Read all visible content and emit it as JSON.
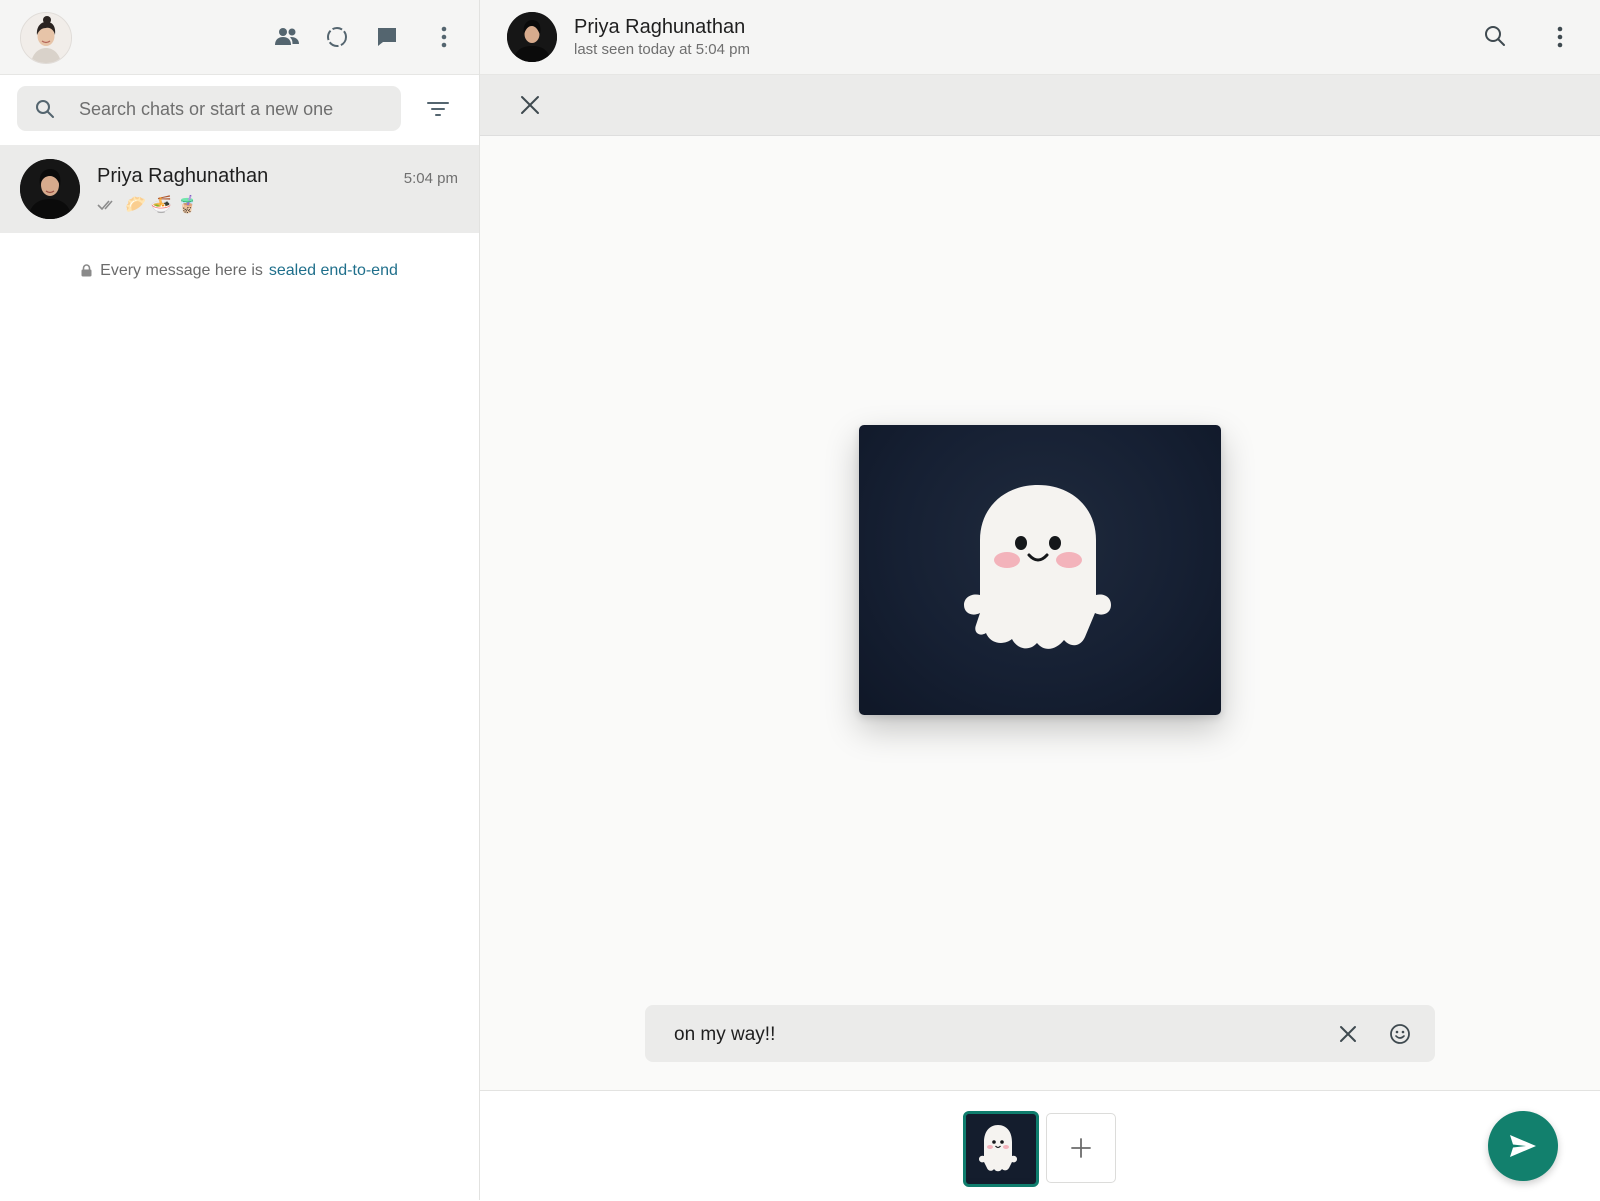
{
  "sidebar": {
    "header": {
      "icons": [
        "communities-icon",
        "status-icon",
        "new-chat-icon",
        "menu-icon"
      ]
    },
    "search": {
      "placeholder": "Search chats or start a new one"
    },
    "chats": [
      {
        "name": "Priya Raghunathan",
        "time": "5:04 pm",
        "preview": "🥟 🍜 🧋"
      }
    ],
    "encryption_notice": {
      "text": "Every message here is",
      "link": "sealed end-to-end"
    }
  },
  "conversation": {
    "contact_name": "Priya Raghunathan",
    "status": "last seen today at 5:04 pm"
  },
  "composer": {
    "caption_value": "on my way!!"
  },
  "colors": {
    "accent": "#12806d",
    "link": "#1f6f8b",
    "media_bg": "#162033"
  }
}
